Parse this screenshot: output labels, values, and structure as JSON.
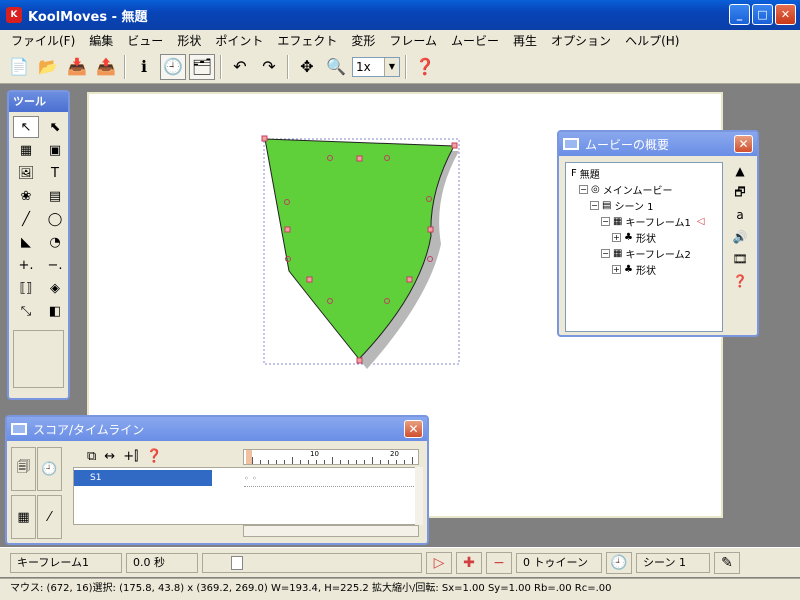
{
  "window": {
    "title": "KoolMoves - 無題",
    "app_icon": "K"
  },
  "menu": [
    "ファイル(F)",
    "編集",
    "ビュー",
    "形状",
    "ポイント",
    "エフェクト",
    "変形",
    "フレーム",
    "ムービー",
    "再生",
    "オプション",
    "ヘルプ(H)"
  ],
  "toolbar": {
    "zoom_value": "1x"
  },
  "tools_panel": {
    "title": "ツール"
  },
  "movie_overview": {
    "title": "ムービーの概要",
    "tree": [
      {
        "label": "無題",
        "indent": 0,
        "icon": "F",
        "expander": ""
      },
      {
        "label": "メインムービー",
        "indent": 1,
        "icon": "◎",
        "expander": "−"
      },
      {
        "label": "シーン 1",
        "indent": 2,
        "icon": "▤",
        "expander": "−"
      },
      {
        "label": "キーフレーム1",
        "indent": 3,
        "icon": "▦",
        "expander": "−",
        "current": true
      },
      {
        "label": "形状",
        "indent": 4,
        "icon": "♣",
        "expander": "+"
      },
      {
        "label": "キーフレーム2",
        "indent": 3,
        "icon": "▦",
        "expander": "−"
      },
      {
        "label": "形状",
        "indent": 4,
        "icon": "♣",
        "expander": "+"
      }
    ]
  },
  "score_panel": {
    "title": "スコア/タイムライン",
    "layer": "S1",
    "ruler_labels": [
      "10",
      "20"
    ]
  },
  "bottom": {
    "keyframe": "キーフレーム1",
    "time": "0.0 秒",
    "tween": "0 トゥイーン",
    "scene": "シーン 1"
  },
  "status": "マウス: (672, 16)選択: (175.8, 43.8) x (369.2, 269.0)  W=193.4,  H=225.2  拡大縮小/回転: Sx=1.00 Sy=1.00 Rb=.00 Rc=.00",
  "colors": {
    "shape_fill": "#5fcf3a",
    "titlebar": "#0a5fd8"
  }
}
